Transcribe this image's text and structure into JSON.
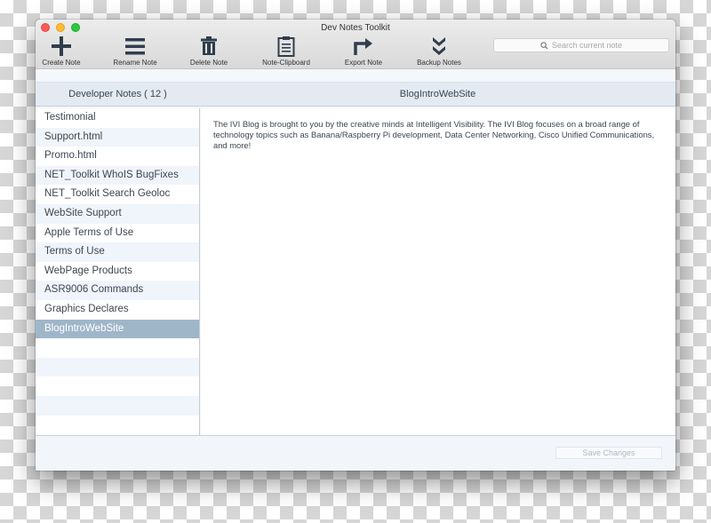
{
  "window": {
    "title": "Dev Notes Toolkit"
  },
  "toolbar": {
    "items": [
      {
        "label": "Create Note",
        "icon": "plus-icon"
      },
      {
        "label": "Rename Note",
        "icon": "menu-lines-icon"
      },
      {
        "label": "Delete Note",
        "icon": "trash-icon"
      },
      {
        "label": "Note-Clipboard",
        "icon": "clipboard-icon"
      },
      {
        "label": "Export Note",
        "icon": "export-arrow-icon"
      },
      {
        "label": "Backup Notes",
        "icon": "double-chevron-down-icon"
      }
    ],
    "search": {
      "placeholder": "Search current note",
      "value": ""
    }
  },
  "header": {
    "list_title": "Developer Notes ( 12 )",
    "note_title": "BlogIntroWebSite"
  },
  "notes": {
    "items": [
      "Testimonial",
      "Support.html",
      "Promo.html",
      "NET_Toolkit WhoIS BugFixes",
      "NET_Toolkit Search Geoloc",
      "WebSite Support",
      "Apple Terms of Use",
      "Terms of Use",
      "WebPage Products",
      "ASR9006 Commands",
      "Graphics Declares",
      "BlogIntroWebSite"
    ],
    "selected_index": 11
  },
  "editor": {
    "text": "The IVI Blog is brought to you by the creative minds at Intelligent Visibility. The IVI Blog focuses on a broad range of technology topics such as Banana/Raspberry Pi development, Data Center Networking, Cisco Unified Communications, and more!"
  },
  "footer": {
    "save_label": "Save Changes",
    "save_enabled": false
  },
  "colors": {
    "selection": "#9fb6c9",
    "icon": "#2f3d4c",
    "header_band": "#e3eaf2",
    "alt_row": "#f0f5fb"
  }
}
